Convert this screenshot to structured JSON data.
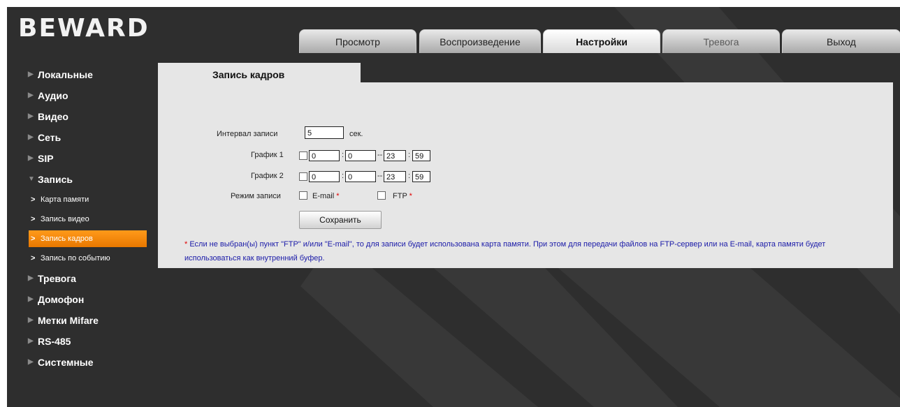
{
  "logo": "BEWARD",
  "tabs": [
    {
      "label": "Просмотр",
      "state": "normal"
    },
    {
      "label": "Воспроизведение",
      "state": "normal"
    },
    {
      "label": "Настройки",
      "state": "active"
    },
    {
      "label": "Тревога",
      "state": "disabled"
    },
    {
      "label": "Выход",
      "state": "normal"
    }
  ],
  "sidebar": {
    "top_items": [
      "Локальные",
      "Аудио",
      "Видео",
      "Сеть",
      "SIP"
    ],
    "expanded_item": "Запись",
    "sub_items": [
      "Карта памяти",
      "Запись видео",
      "Запись кадров",
      "Запись по событию"
    ],
    "active_sub_item": "Запись кадров",
    "bottom_items": [
      "Тревога",
      "Домофон",
      "Метки Mifare",
      "RS-485",
      "Системные"
    ]
  },
  "panel": {
    "title": "Запись кадров",
    "interval": {
      "label": "Интервал записи",
      "value": "5",
      "unit": "сек."
    },
    "schedule1": {
      "label": "График 1",
      "checked": false,
      "start_h": "0",
      "start_m": "0",
      "end_h": "23",
      "end_m": "59"
    },
    "schedule2": {
      "label": "График 2",
      "checked": false,
      "start_h": "0",
      "start_m": "0",
      "end_h": "23",
      "end_m": "59"
    },
    "mode": {
      "label": "Режим записи",
      "email_label": "E-mail",
      "ftp_label": "FTP",
      "star": "*"
    },
    "save_label": "Сохранить",
    "note_star": "*",
    "note_text": " Если не выбран(ы) пункт \"FTP\" и/или \"E-mail\", то для записи будет использована карта памяти. При этом для передачи файлов на FTP-сервер или на E-mail, карта памяти будет использоваться как внутренний буфер."
  },
  "colors": {
    "background": "#2e2e2e",
    "panel": "#e6e6e6",
    "accent": "#f08a00",
    "note": "#1a1aa8",
    "required_star": "#e00000"
  }
}
